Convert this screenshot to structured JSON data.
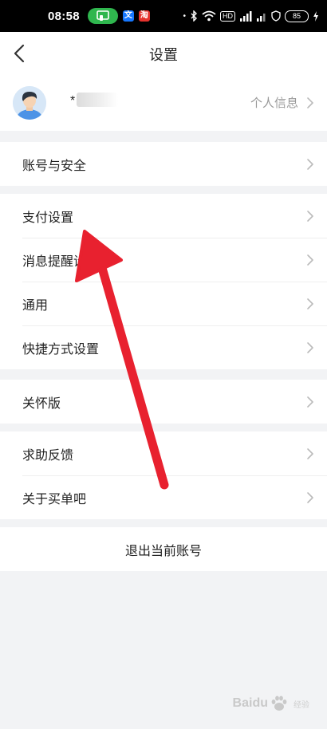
{
  "status_bar": {
    "time": "08:58",
    "hd_label": "HD",
    "battery": "85"
  },
  "header": {
    "title": "设置",
    "back_icon": "chevron-left-icon"
  },
  "profile": {
    "nickname_prefix": "*",
    "personal_info_label": "个人信息",
    "avatar_icon": "user-avatar-icon"
  },
  "groups": [
    {
      "items": [
        {
          "label": "账号与安全"
        }
      ]
    },
    {
      "items": [
        {
          "label": "支付设置"
        },
        {
          "label": "消息提醒设置"
        },
        {
          "label": "通用"
        },
        {
          "label": "快捷方式设置"
        }
      ]
    },
    {
      "items": [
        {
          "label": "关怀版"
        }
      ]
    },
    {
      "items": [
        {
          "label": "求助反馈"
        },
        {
          "label": "关于买单吧"
        }
      ]
    }
  ],
  "logout_label": "退出当前账号",
  "annotation": {
    "arrow_color": "#e8212f"
  },
  "watermark": {
    "brand": "Baidu",
    "sub": "经验"
  }
}
